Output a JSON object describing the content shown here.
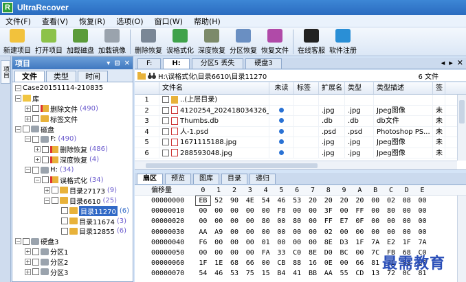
{
  "app": {
    "title": "UltraRecover",
    "logo_letter": "R"
  },
  "menu": [
    "文件(F)",
    "查看(V)",
    "恢复(R)",
    "选项(O)",
    "窗口(W)",
    "帮助(H)"
  ],
  "toolbar": [
    {
      "label": "新建项目",
      "icon": "new-project-icon",
      "color": "#f2c23c"
    },
    {
      "label": "打开项目",
      "icon": "open-project-icon",
      "color": "#8cc24a"
    },
    {
      "label": "加载磁盘",
      "icon": "load-disk-icon",
      "color": "#5b9b3a"
    },
    {
      "label": "加载镜像",
      "icon": "load-image-icon",
      "color": "#9aa3ad"
    },
    {
      "label": "删除恢复",
      "icon": "delete-recover-icon",
      "color": "#7a8796"
    },
    {
      "label": "误格式化",
      "icon": "format-recover-icon",
      "color": "#3fa24a"
    },
    {
      "label": "深度恢复",
      "icon": "deep-recover-icon",
      "color": "#7c8a6a"
    },
    {
      "label": "分区恢复",
      "icon": "partition-recover-icon",
      "color": "#6a8fc2"
    },
    {
      "label": "恢复文件",
      "icon": "recover-file-icon",
      "color": "#b04aa8"
    },
    {
      "label": "在线客服",
      "icon": "qq-icon",
      "color": "#222"
    },
    {
      "label": "软件注册",
      "icon": "register-icon",
      "color": "#2a8fd6"
    }
  ],
  "left_strip": {
    "tab": "项目"
  },
  "project_panel": {
    "title": "项目",
    "controls": [
      "▾",
      "⊟",
      "✕"
    ],
    "tabs": [
      "文件",
      "类型",
      "时间"
    ],
    "tree": [
      {
        "indent": 4,
        "exp": "⊟",
        "chk": false,
        "icon": "none",
        "label": "Case20151114-210835",
        "count": ""
      },
      {
        "indent": 4,
        "exp": "⊟",
        "chk": false,
        "icon": "lib",
        "label": "库",
        "count": ""
      },
      {
        "indent": 18,
        "exp": "⊞",
        "chk": true,
        "icon": "folder-red",
        "label": "删除文件",
        "count": "(490)"
      },
      {
        "indent": 18,
        "exp": "⊞",
        "chk": true,
        "icon": "folder",
        "label": "标签文件",
        "count": ""
      },
      {
        "indent": 4,
        "exp": "⊟",
        "chk": true,
        "icon": "drive",
        "label": "磁盘",
        "count": ""
      },
      {
        "indent": 18,
        "exp": "⊟",
        "chk": true,
        "icon": "drive",
        "label": "F:",
        "count": "(490)"
      },
      {
        "indent": 32,
        "exp": "⊞",
        "chk": true,
        "icon": "folder-red",
        "label": "删除恢复",
        "count": "(486)"
      },
      {
        "indent": 32,
        "exp": "⊞",
        "chk": true,
        "icon": "folder-red",
        "label": "深度恢复",
        "count": "(4)"
      },
      {
        "indent": 18,
        "exp": "⊟",
        "chk": true,
        "icon": "drive",
        "label": "H:",
        "count": "(34)"
      },
      {
        "indent": 32,
        "exp": "⊟",
        "chk": true,
        "icon": "folder-red",
        "label": "误格式化",
        "count": "(34)"
      },
      {
        "indent": 46,
        "exp": "⊞",
        "chk": true,
        "icon": "folder",
        "label": "目录27173",
        "count": "(9)"
      },
      {
        "indent": 46,
        "exp": "⊟",
        "chk": true,
        "icon": "folder",
        "label": "目录6610",
        "count": "(25)"
      },
      {
        "indent": 60,
        "exp": "",
        "chk": true,
        "icon": "folder",
        "label": "目录11270",
        "count": "(6)",
        "selected": true
      },
      {
        "indent": 60,
        "exp": "",
        "chk": true,
        "icon": "folder",
        "label": "目录11674",
        "count": "(3)"
      },
      {
        "indent": 60,
        "exp": "",
        "chk": true,
        "icon": "folder",
        "label": "目录12855",
        "count": "(6)"
      },
      {
        "indent": 4,
        "exp": "⊟",
        "chk": true,
        "icon": "drive",
        "label": "硬盘3",
        "count": ""
      },
      {
        "indent": 18,
        "exp": "⊞",
        "chk": true,
        "icon": "drive",
        "label": "分区1",
        "count": ""
      },
      {
        "indent": 18,
        "exp": "⊞",
        "chk": true,
        "icon": "drive",
        "label": "分区2",
        "count": ""
      },
      {
        "indent": 18,
        "exp": "⊞",
        "chk": true,
        "icon": "drive",
        "label": "分区3",
        "count": ""
      }
    ]
  },
  "doc_tabs": [
    "F:",
    "H:",
    "分区5 丢失",
    "硬盘3"
  ],
  "doc_tab_controls": [
    "◂",
    "▸",
    "✕"
  ],
  "path": {
    "text": "H:\\误格式化\\目录6610\\目录11270",
    "count": "6 文件"
  },
  "file_list": {
    "columns": [
      "",
      "文件名",
      "未读",
      "标签",
      "扩展名",
      "类型",
      "类型描述",
      "签"
    ],
    "rows": [
      {
        "num": "1",
        "name": "..(上层目录)",
        "unread": false,
        "ext": "",
        "type": "",
        "desc": "",
        "more": "",
        "icon": "folder"
      },
      {
        "num": "2",
        "name": "4120254_202418034326_2.jpg",
        "unread": true,
        "ext": ".jpg",
        "type": ".jpg",
        "desc": "Jpeg图像",
        "more": "未",
        "icon": "file"
      },
      {
        "num": "3",
        "name": "Thumbs.db",
        "unread": true,
        "ext": ".db",
        "type": ".db",
        "desc": "db文件",
        "more": "未",
        "icon": "file"
      },
      {
        "num": "4",
        "name": "人-1.psd",
        "unread": true,
        "ext": ".psd",
        "type": ".psd",
        "desc": "Photoshop PS...",
        "more": "未",
        "icon": "file"
      },
      {
        "num": "5",
        "name": "1671115188.jpg",
        "unread": true,
        "ext": ".jpg",
        "type": ".jpg",
        "desc": "Jpeg图像",
        "more": "未",
        "icon": "file"
      },
      {
        "num": "6",
        "name": "288593048.jpg",
        "unread": true,
        "ext": ".jpg",
        "type": ".jpg",
        "desc": "Jpeg图像",
        "more": "未",
        "icon": "file"
      }
    ]
  },
  "hex_tabs": [
    "扇区",
    "预览",
    "图库",
    "目录",
    "递归"
  ],
  "hex": {
    "offset_label": "偏移量",
    "columns": [
      "0",
      "1",
      "2",
      "3",
      "4",
      "5",
      "6",
      "7",
      "8",
      "9",
      "A",
      "B",
      "C",
      "D",
      "E"
    ],
    "rows": [
      {
        "off": "00000000",
        "bytes": [
          "EB",
          "52",
          "90",
          "4E",
          "54",
          "46",
          "53",
          "20",
          "20",
          "20",
          "20",
          "00",
          "02",
          "08",
          "00"
        ]
      },
      {
        "off": "00000010",
        "bytes": [
          "00",
          "00",
          "00",
          "00",
          "00",
          "F8",
          "00",
          "00",
          "3F",
          "00",
          "FF",
          "00",
          "80",
          "00",
          "00"
        ]
      },
      {
        "off": "00000020",
        "bytes": [
          "00",
          "00",
          "00",
          "00",
          "80",
          "00",
          "80",
          "00",
          "FF",
          "E7",
          "0F",
          "00",
          "00",
          "00",
          "00"
        ]
      },
      {
        "off": "00000030",
        "bytes": [
          "AA",
          "A9",
          "00",
          "00",
          "00",
          "00",
          "00",
          "00",
          "02",
          "00",
          "00",
          "00",
          "00",
          "00",
          "00"
        ]
      },
      {
        "off": "00000040",
        "bytes": [
          "F6",
          "00",
          "00",
          "00",
          "01",
          "00",
          "00",
          "00",
          "8E",
          "D3",
          "1F",
          "7A",
          "E2",
          "1F",
          "7A"
        ]
      },
      {
        "off": "00000050",
        "bytes": [
          "00",
          "00",
          "00",
          "00",
          "FA",
          "33",
          "C0",
          "8E",
          "D0",
          "BC",
          "00",
          "7C",
          "FB",
          "68",
          "C0"
        ]
      },
      {
        "off": "00000060",
        "bytes": [
          "1F",
          "1E",
          "68",
          "66",
          "00",
          "CB",
          "88",
          "16",
          "0E",
          "00",
          "66",
          "81",
          "3E",
          "03",
          "00"
        ]
      },
      {
        "off": "00000070",
        "bytes": [
          "54",
          "46",
          "53",
          "75",
          "15",
          "B4",
          "41",
          "BB",
          "AA",
          "55",
          "CD",
          "13",
          "72",
          "0C",
          "81"
        ]
      }
    ]
  },
  "watermark": "最需教育"
}
